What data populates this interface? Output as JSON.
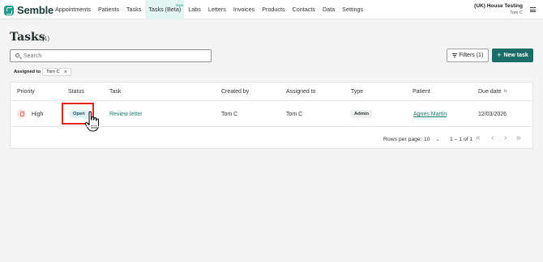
{
  "app": {
    "name": "Semble"
  },
  "nav": {
    "items": [
      {
        "label": "Appointments"
      },
      {
        "label": "Patients"
      },
      {
        "label": "Tasks"
      },
      {
        "label": "Tasks (Beta)",
        "badge": "New",
        "active": true
      },
      {
        "label": "Labs"
      },
      {
        "label": "Letters"
      },
      {
        "label": "Invoices"
      },
      {
        "label": "Products"
      },
      {
        "label": "Contacts"
      },
      {
        "label": "Data"
      },
      {
        "label": "Settings"
      }
    ],
    "org_name": "(UK) House Testing",
    "user_name": "Tom C"
  },
  "page": {
    "title": "Tasks",
    "count": "(1)"
  },
  "search": {
    "placeholder": "Search"
  },
  "toolbar": {
    "filters_label": "Filters (1)",
    "new_task_label": "New task"
  },
  "filter_chip": {
    "label": "Assigned to",
    "value": "Tom C"
  },
  "table": {
    "headers": [
      "Priority",
      "Status",
      "Task",
      "Created by",
      "Assigned to",
      "Type",
      "Patient",
      "Due date"
    ],
    "rows": [
      {
        "priority": "High",
        "status": "Open",
        "task": "Review letter",
        "created_by": "Tom C",
        "assigned_to": "Tom C",
        "type": "Admin",
        "patient": "Agnes Martin",
        "due_date": "12/03/2026"
      }
    ]
  },
  "pagination": {
    "rows_per_page_label": "Rows per page:",
    "rows_per_page": "10",
    "range": "1 – 1 of 1"
  },
  "colors": {
    "brand": "#1b6e67",
    "accent_link": "#1a7a72",
    "highlight": "#e3261c"
  }
}
